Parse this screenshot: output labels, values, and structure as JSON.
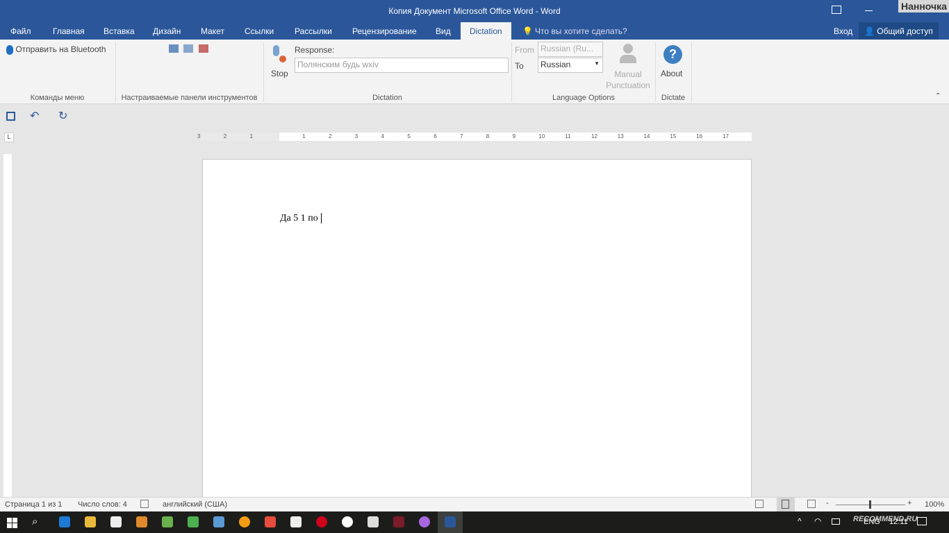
{
  "window": {
    "title": "Копия Документ Microsoft Office Word - Word",
    "watermark_user": "Нанночка"
  },
  "tabs": [
    {
      "label": "Файл"
    },
    {
      "label": "Главная"
    },
    {
      "label": "Вставка"
    },
    {
      "label": "Дизайн"
    },
    {
      "label": "Макет"
    },
    {
      "label": "Ссылки"
    },
    {
      "label": "Рассылки"
    },
    {
      "label": "Рецензирование"
    },
    {
      "label": "Вид"
    },
    {
      "label": "Dictation",
      "active": true
    }
  ],
  "tell_me": "Что вы хотите сделать?",
  "signin": "Вход",
  "share": "Общий доступ",
  "ribbon": {
    "bluetooth": "Отправить на Bluetooth",
    "group_menu": "Команды меню",
    "group_toolbars": "Настраиваемые панели инструментов",
    "stop": "Stop",
    "response_label": "Response:",
    "response_value": "Полянским будь wxiv",
    "group_dictation": "Dictation",
    "from_label": "From",
    "from_value": "Russian (Ru...",
    "to_label": "To",
    "to_value": "Russian",
    "manual_punct_1": "Manual",
    "manual_punct_2": "Punctuation",
    "group_lang": "Language Options",
    "about": "About",
    "group_dictate": "Dictate"
  },
  "ruler": [
    "3",
    "2",
    "1",
    "",
    "1",
    "2",
    "3",
    "4",
    "5",
    "6",
    "7",
    "8",
    "9",
    "10",
    "11",
    "12",
    "13",
    "14",
    "15",
    "16",
    "17"
  ],
  "document": {
    "text": "Да 5 1 по "
  },
  "status": {
    "page": "Страница 1 из 1",
    "words": "Число слов: 4",
    "language": "английский (США)",
    "zoom": "100%",
    "zoom_level": 100
  },
  "tray": {
    "lang": "ENG",
    "time": "12:11",
    "watermark": "RECOMMEND.RU"
  },
  "colors": {
    "accent": "#2b579a"
  }
}
